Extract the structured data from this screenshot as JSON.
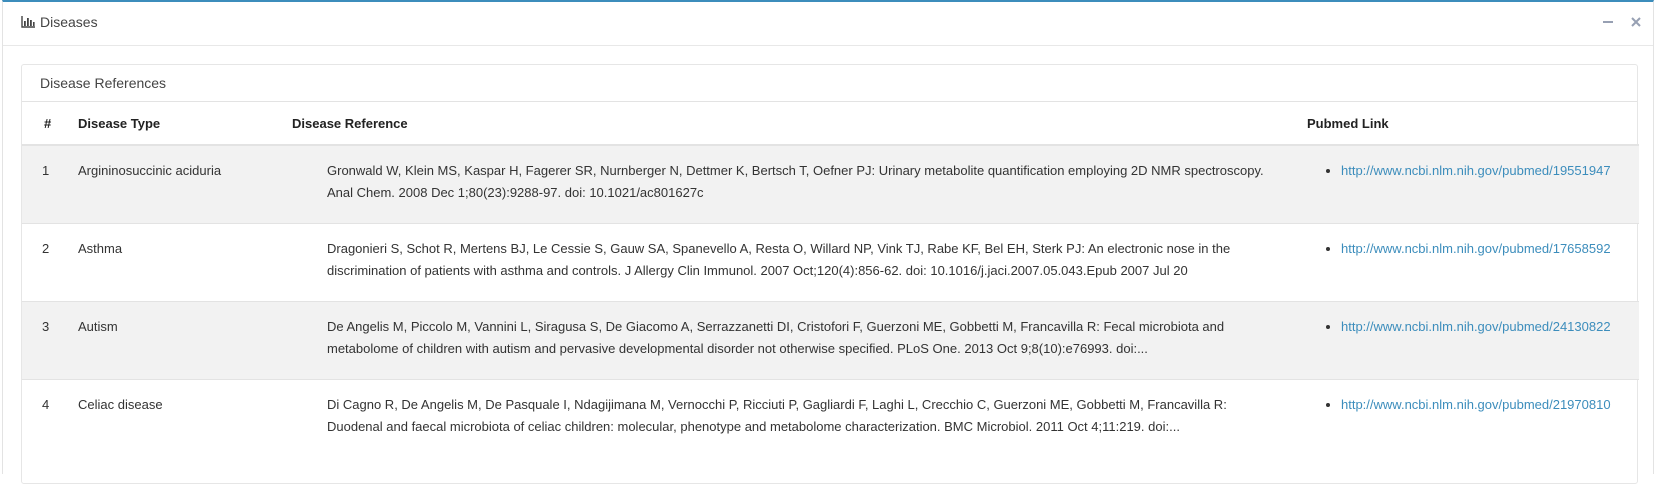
{
  "box": {
    "title": "Diseases",
    "title_icon": "bar-chart-icon",
    "minimize_icon": "minus-icon",
    "close_icon": "close-icon"
  },
  "panel": {
    "heading": "Disease References"
  },
  "table": {
    "headers": {
      "num": "#",
      "type": "Disease Type",
      "reference": "Disease Reference",
      "link": "Pubmed Link"
    },
    "rows": [
      {
        "num": "1",
        "type": "Argininosuccinic aciduria",
        "reference": "Gronwald W, Klein MS, Kaspar H, Fagerer SR, Nurnberger N, Dettmer K, Bertsch T, Oefner PJ: Urinary metabolite quantification employing 2D NMR spectroscopy. Anal Chem. 2008 Dec 1;80(23):9288-97. doi: 10.1021/ac801627c",
        "link": "http://www.ncbi.nlm.nih.gov/pubmed/19551947"
      },
      {
        "num": "2",
        "type": "Asthma",
        "reference": "Dragonieri S, Schot R, Mertens BJ, Le Cessie S, Gauw SA, Spanevello A, Resta O, Willard NP, Vink TJ, Rabe KF, Bel EH, Sterk PJ: An electronic nose in the discrimination of patients with asthma and controls. J Allergy Clin Immunol. 2007 Oct;120(4):856-62. doi: 10.1016/j.jaci.2007.05.043.Epub 2007 Jul 20",
        "link": "http://www.ncbi.nlm.nih.gov/pubmed/17658592"
      },
      {
        "num": "3",
        "type": "Autism",
        "reference": "De Angelis M, Piccolo M, Vannini L, Siragusa S, De Giacomo A, Serrazzanetti DI, Cristofori F, Guerzoni ME, Gobbetti M, Francavilla R: Fecal microbiota and metabolome of children with autism and pervasive developmental disorder not otherwise specified. PLoS One. 2013 Oct 9;8(10):e76993. doi:...",
        "link": "http://www.ncbi.nlm.nih.gov/pubmed/24130822"
      },
      {
        "num": "4",
        "type": "Celiac disease",
        "reference": "Di Cagno R, De Angelis M, De Pasquale I, Ndagijimana M, Vernocchi P, Ricciuti P, Gagliardi F, Laghi L, Crecchio C, Guerzoni ME, Gobbetti M, Francavilla R: Duodenal and faecal microbiota of celiac children: molecular, phenotype and metabolome characterization. BMC Microbiol. 2011 Oct 4;11:219. doi:...",
        "link": "http://www.ncbi.nlm.nih.gov/pubmed/21970810"
      }
    ]
  },
  "colors": {
    "accent": "#3c8dbc",
    "stripe": "#f2f2f2"
  }
}
